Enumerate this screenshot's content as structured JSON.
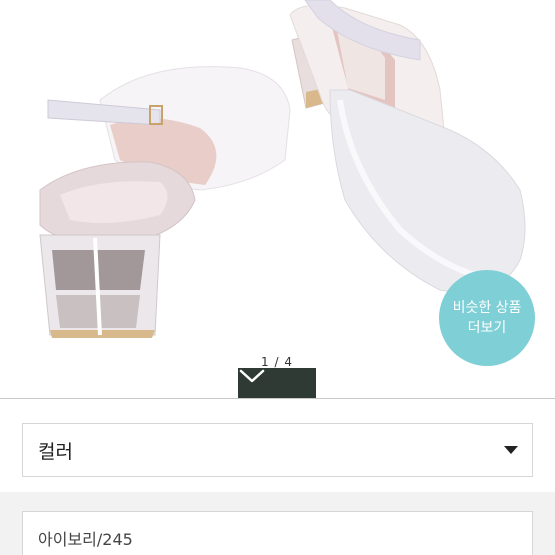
{
  "gallery": {
    "page_indicator": "1 / 4",
    "similar_button": {
      "line1": "비슷한 상품",
      "line2": "더보기"
    },
    "collapse_icon": "chevron-down-icon"
  },
  "options": {
    "color_select_label": "컬러",
    "selected_option_text": "아이보리/245"
  },
  "colors": {
    "accent_teal": "#7fcfd6",
    "tab_dark": "#2f3a34"
  }
}
